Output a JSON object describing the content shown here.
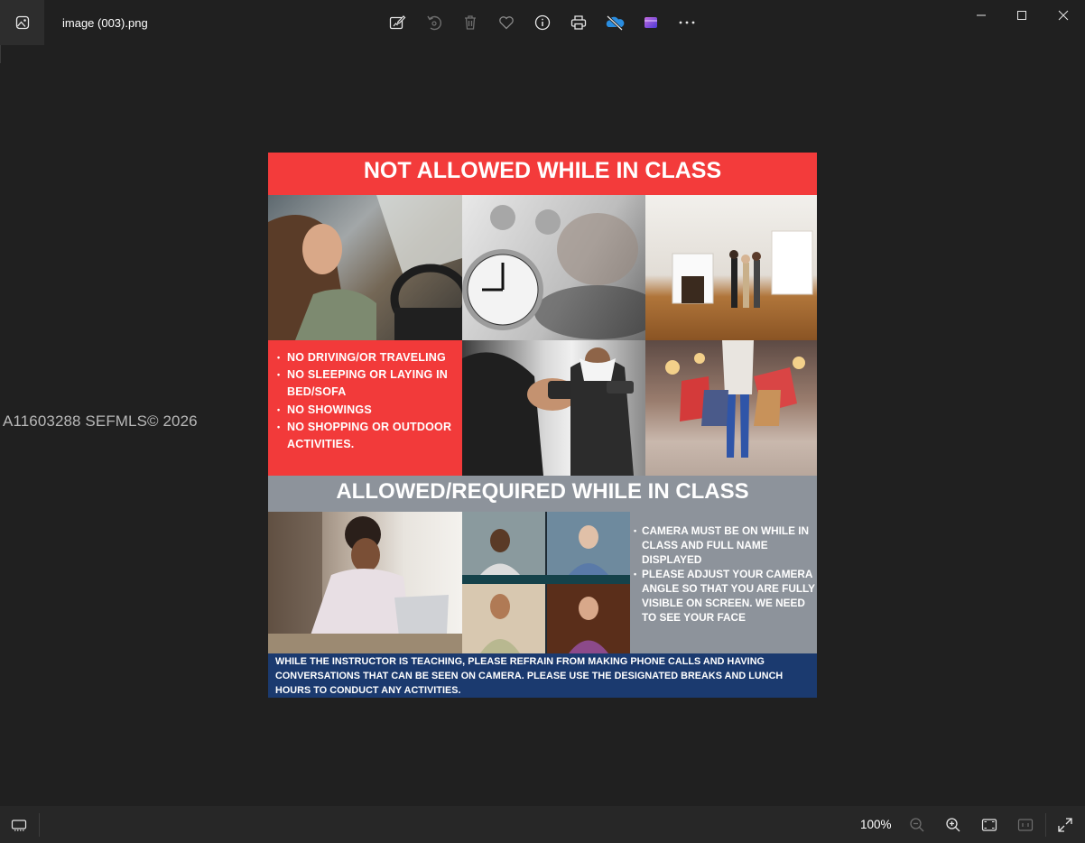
{
  "window": {
    "file_name": "image (003).png"
  },
  "toolbar": {
    "icons": [
      "edit-image-icon",
      "rotate-icon",
      "delete-icon",
      "favorite-icon",
      "info-icon",
      "print-icon",
      "onedrive-icon",
      "clipchamp-icon",
      "more-icon"
    ]
  },
  "watermark": {
    "text": "A11603288  SEFMLS© 2026"
  },
  "flyer": {
    "heading_not_allowed": "NOT ALLOWED WHILE IN CLASS",
    "not_allowed_items": [
      "NO DRIVING/OR TRAVELING",
      "NO SLEEPING OR LAYING IN BED/SOFA",
      "NO SHOWINGS",
      "NO SHOPPING OR OUTDOOR ACTIVITIES."
    ],
    "heading_allowed": "ALLOWED/REQUIRED WHILE IN CLASS",
    "allowed_items": [
      "CAMERA MUST BE ON WHILE IN CLASS AND FULL NAME DISPLAYED",
      "PLEASE ADJUST YOUR CAMERA ANGLE SO THAT YOU ARE FULLY VISIBLE ON SCREEN. WE NEED TO SEE YOUR FACE"
    ],
    "footer_note": "WHILE THE INSTRUCTOR IS TEACHING, PLEASE REFRAIN FROM MAKING PHONE CALLS AND HAVING CONVERSATIONS THAT CAN BE SEEN ON CAMERA. PLEASE USE THE DESIGNATED BREAKS AND LUNCH HOURS TO CONDUCT ANY ACTIVITIES.",
    "colors": {
      "red": "#f23a3a",
      "grey": "#8d939b",
      "navy": "#1b3a6f"
    }
  },
  "statusbar": {
    "zoom": "100%"
  }
}
